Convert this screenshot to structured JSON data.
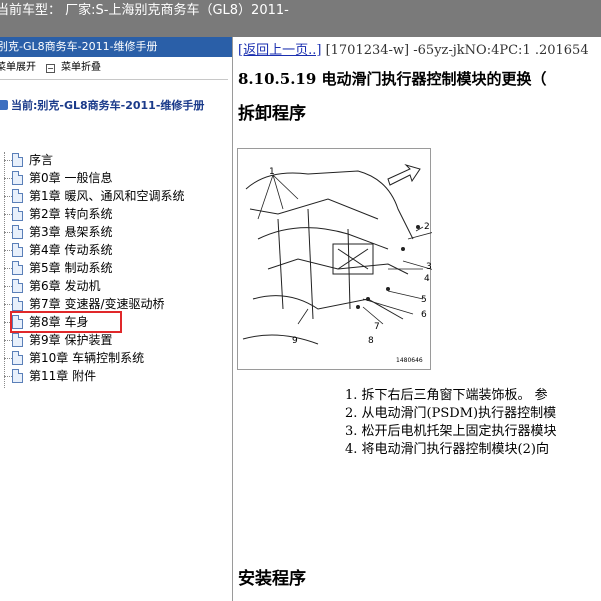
{
  "header": {
    "title": "当前车型：  厂家:S-上海别克商务车（GL8）2011-"
  },
  "sidebar": {
    "title": "别克-GL8商务车-2011-维修手册",
    "toolbar": {
      "expand_label": "菜单展开",
      "collapse_label": "菜单折叠"
    },
    "root_label": "当前:别克-GL8商务车-2011-维修手册",
    "items": [
      {
        "label": "序言"
      },
      {
        "label": "第0章 一般信息"
      },
      {
        "label": "第1章 暖风、通风和空调系统"
      },
      {
        "label": "第2章 转向系统"
      },
      {
        "label": "第3章 悬架系统"
      },
      {
        "label": "第4章 传动系统"
      },
      {
        "label": "第5章 制动系统"
      },
      {
        "label": "第6章 发动机"
      },
      {
        "label": "第7章 变速器/变速驱动桥"
      },
      {
        "label": "第8章 车身"
      },
      {
        "label": "第9章 保护装置"
      },
      {
        "label": "第10章 车辆控制系统"
      },
      {
        "label": "第11章 附件"
      }
    ],
    "highlighted_index": 9
  },
  "content": {
    "back_link": "[返回上一页..]",
    "nav_meta": "[1701234-w] -65yz-jkNO:4PC:1 .201654",
    "section_title": "8.10.5.19 电动滑门执行器控制模块的更换（",
    "remove_heading": "拆卸程序",
    "figure_labels": [
      "1",
      "2",
      "3",
      "4",
      "5",
      "6",
      "7",
      "8",
      "9",
      "1480646"
    ],
    "steps": [
      "1. 拆下右后三角窗下端装饰板。 参",
      "2. 从电动滑门(PSDM)执行器控制模",
      "3. 松开后电机托架上固定执行器模块",
      "4. 将电动滑门执行器控制模块(2)向"
    ],
    "install_heading": "安装程序"
  },
  "colors": {
    "topbar": "#7a7a7a",
    "sidebar_title": "#2a5fa8",
    "highlight": "#e0282a",
    "link": "#1a2fb0"
  }
}
